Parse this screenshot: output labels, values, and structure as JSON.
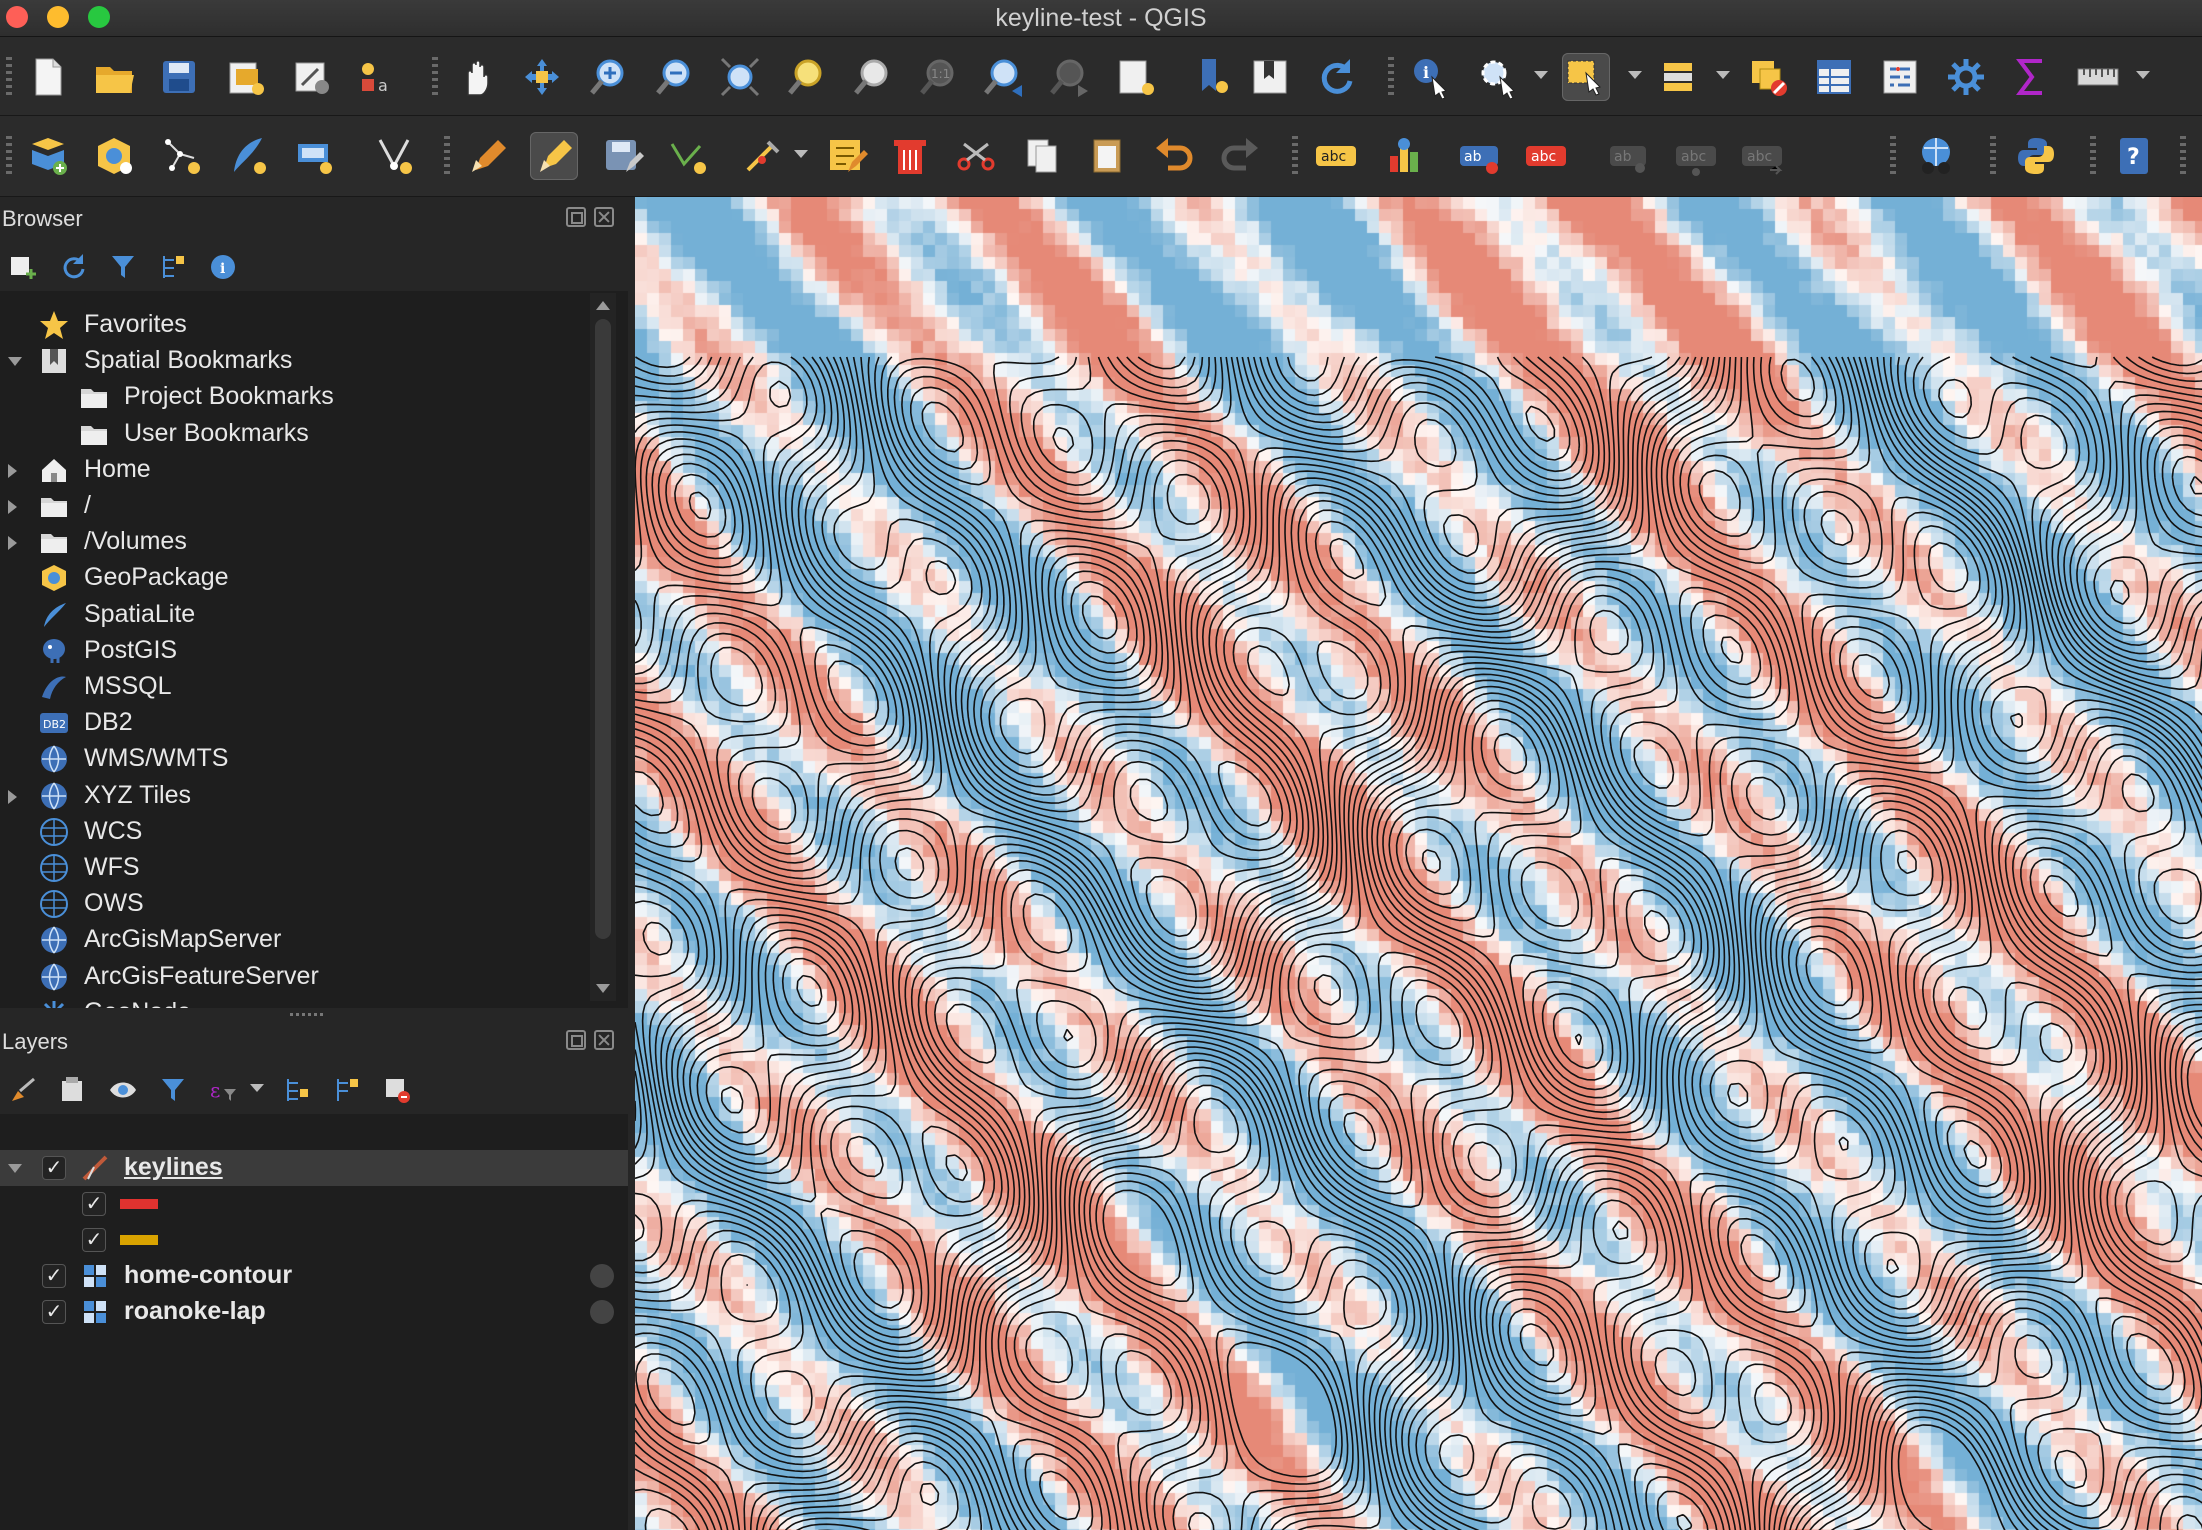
{
  "window": {
    "title": "keyline-test - QGIS"
  },
  "browser": {
    "title": "Browser",
    "items": [
      {
        "label": "Favorites",
        "icon": "star-icon",
        "expand": "none",
        "indent": 0
      },
      {
        "label": "Spatial Bookmarks",
        "icon": "bookmark-icon",
        "expand": "down",
        "indent": 0
      },
      {
        "label": "Project Bookmarks",
        "icon": "folder-icon",
        "expand": "none",
        "indent": 1
      },
      {
        "label": "User Bookmarks",
        "icon": "folder-icon",
        "expand": "none",
        "indent": 1
      },
      {
        "label": "Home",
        "icon": "home-icon",
        "expand": "right",
        "indent": 0
      },
      {
        "label": "/",
        "icon": "folder-icon",
        "expand": "right",
        "indent": 0
      },
      {
        "label": "/Volumes",
        "icon": "folder-icon",
        "expand": "right",
        "indent": 0
      },
      {
        "label": "GeoPackage",
        "icon": "geopackage-icon",
        "expand": "none",
        "indent": 0
      },
      {
        "label": "SpatiaLite",
        "icon": "feather-icon",
        "expand": "none",
        "indent": 0
      },
      {
        "label": "PostGIS",
        "icon": "elephant-icon",
        "expand": "none",
        "indent": 0
      },
      {
        "label": "MSSQL",
        "icon": "mssql-icon",
        "expand": "none",
        "indent": 0
      },
      {
        "label": "DB2",
        "icon": "db2-icon",
        "expand": "none",
        "indent": 0
      },
      {
        "label": "WMS/WMTS",
        "icon": "globe-icon",
        "expand": "none",
        "indent": 0
      },
      {
        "label": "XYZ Tiles",
        "icon": "globe-icon",
        "expand": "right",
        "indent": 0
      },
      {
        "label": "WCS",
        "icon": "globe-grid-icon",
        "expand": "none",
        "indent": 0
      },
      {
        "label": "WFS",
        "icon": "globe-grid-icon",
        "expand": "none",
        "indent": 0
      },
      {
        "label": "OWS",
        "icon": "globe-grid-icon",
        "expand": "none",
        "indent": 0
      },
      {
        "label": "ArcGisMapServer",
        "icon": "globe-icon",
        "expand": "none",
        "indent": 0
      },
      {
        "label": "ArcGisFeatureServer",
        "icon": "globe-icon",
        "expand": "none",
        "indent": 0
      },
      {
        "label": "GeoNode",
        "icon": "geonode-icon",
        "expand": "none",
        "indent": 0
      }
    ],
    "db2_badge": "DB2"
  },
  "layers": {
    "title": "Layers",
    "items": [
      {
        "label": "keylines",
        "type": "vector-line",
        "checked": true,
        "expanded": true,
        "selected": true
      },
      {
        "label": "",
        "type": "legend-swatch",
        "checked": true,
        "color": "#e0322f"
      },
      {
        "label": "",
        "type": "legend-swatch",
        "checked": true,
        "color": "#d9a300"
      },
      {
        "label": "home-contour",
        "type": "raster",
        "checked": true
      },
      {
        "label": "roanoke-lap",
        "type": "raster",
        "checked": true
      }
    ]
  },
  "toolbar": {
    "label_abc": "abc",
    "label_ab": "ab"
  },
  "colors": {
    "map_red": "#e8a08f",
    "map_blue": "#7fb0d6",
    "contour": "#111111"
  }
}
